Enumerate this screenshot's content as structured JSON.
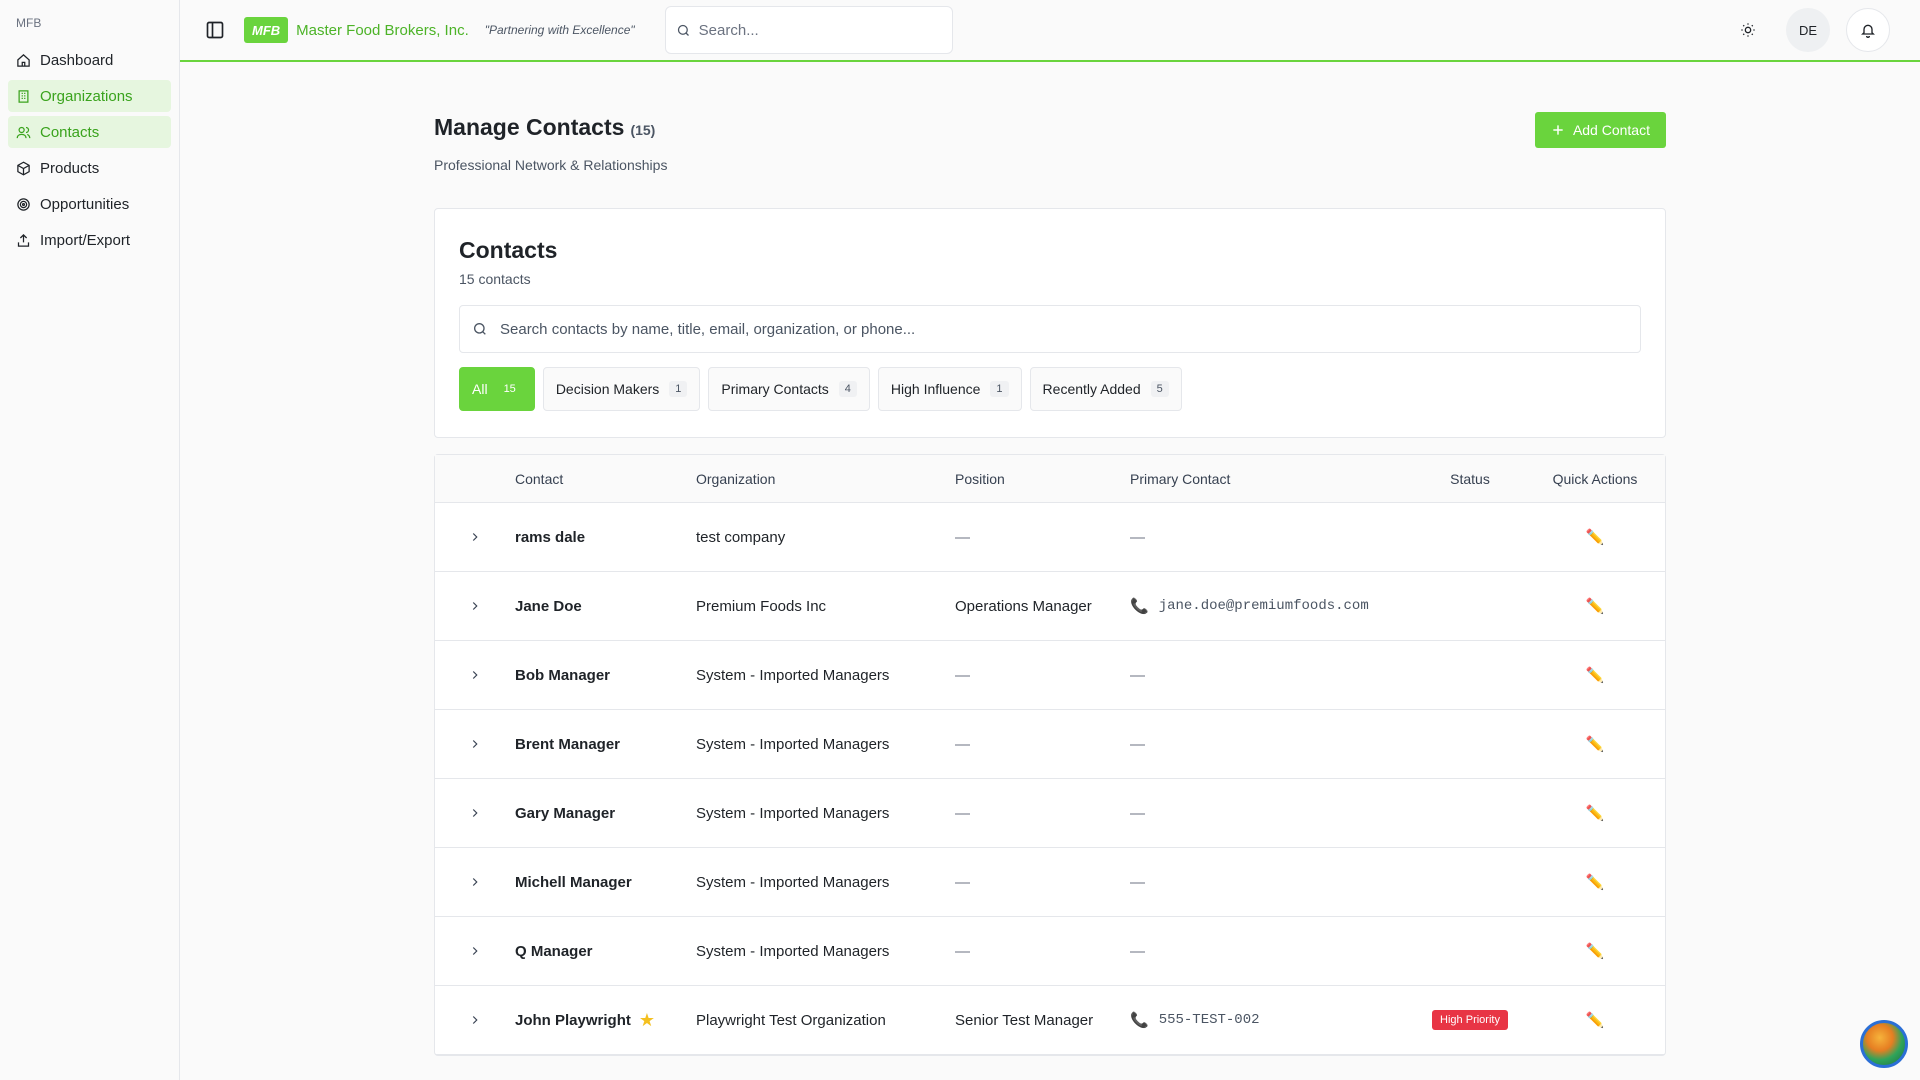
{
  "sidebar": {
    "brand": "MFB",
    "items": [
      {
        "label": "Dashboard",
        "icon": "home-icon"
      },
      {
        "label": "Organizations",
        "icon": "building-icon",
        "active": true
      },
      {
        "label": "Contacts",
        "icon": "users-icon",
        "active": true
      },
      {
        "label": "Products",
        "icon": "package-icon"
      },
      {
        "label": "Opportunities",
        "icon": "target-icon"
      },
      {
        "label": "Import/Export",
        "icon": "upload-icon"
      }
    ]
  },
  "header": {
    "logo": "MFB",
    "company": "Master Food Brokers, Inc.",
    "tagline": "\"Partnering with Excellence\"",
    "search_placeholder": "Search...",
    "avatar_initials": "DE"
  },
  "page": {
    "title": "Manage Contacts",
    "title_count": "(15)",
    "subtitle": "Professional Network & Relationships",
    "add_button": "Add Contact"
  },
  "card": {
    "title": "Contacts",
    "count": "15 contacts",
    "search_placeholder": "Search contacts by name, title, email, organization, or phone...",
    "filters": [
      {
        "label": "All",
        "count": "15",
        "active": true
      },
      {
        "label": "Decision Makers",
        "count": "1"
      },
      {
        "label": "Primary Contacts",
        "count": "4"
      },
      {
        "label": "High Influence",
        "count": "1"
      },
      {
        "label": "Recently Added",
        "count": "5"
      }
    ]
  },
  "table": {
    "columns": {
      "contact": "Contact",
      "organization": "Organization",
      "position": "Position",
      "primary": "Primary Contact",
      "status": "Status",
      "actions": "Quick Actions"
    },
    "rows": [
      {
        "name": "rams dale",
        "org": "test company",
        "position": "—",
        "primary": "—",
        "phone_icon": false,
        "status": "",
        "starred": false
      },
      {
        "name": "Jane Doe",
        "org": "Premium Foods Inc",
        "position": "Operations Manager",
        "primary": "jane.doe@premiumfoods.com",
        "phone_icon": true,
        "status": "",
        "starred": false
      },
      {
        "name": "Bob Manager",
        "org": "System - Imported Managers",
        "position": "—",
        "primary": "—",
        "phone_icon": false,
        "status": "",
        "starred": false
      },
      {
        "name": "Brent Manager",
        "org": "System - Imported Managers",
        "position": "—",
        "primary": "—",
        "phone_icon": false,
        "status": "",
        "starred": false
      },
      {
        "name": "Gary Manager",
        "org": "System - Imported Managers",
        "position": "—",
        "primary": "—",
        "phone_icon": false,
        "status": "",
        "starred": false
      },
      {
        "name": "Michell Manager",
        "org": "System - Imported Managers",
        "position": "—",
        "primary": "—",
        "phone_icon": false,
        "status": "",
        "starred": false
      },
      {
        "name": "Q Manager",
        "org": "System - Imported Managers",
        "position": "—",
        "primary": "—",
        "phone_icon": false,
        "status": "",
        "starred": false
      },
      {
        "name": "John Playwright",
        "org": "Playwright Test Organization",
        "position": "Senior Test Manager",
        "primary": "555-TEST-002",
        "phone_icon": true,
        "status": "High Priority",
        "starred": true
      }
    ]
  },
  "colors": {
    "accent": "#6ad43d",
    "accent_text": "#4cb327",
    "active_bg": "#e6f6df",
    "danger": "#e83545"
  }
}
